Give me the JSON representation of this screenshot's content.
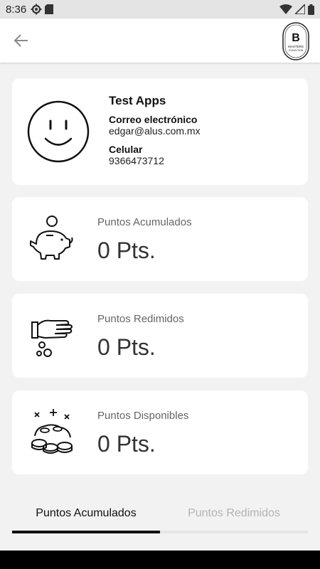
{
  "status_bar": {
    "time": "8:36"
  },
  "app_bar": {
    "back_icon": "arrow-left-icon",
    "logo_letter": "B",
    "logo_line1": "MASTERS",
    "logo_line2": "COLLECTION"
  },
  "profile": {
    "name": "Test Apps",
    "email_label": "Correo electrónico",
    "email": "edgar@alus.com.mx",
    "phone_label": "Celular",
    "phone": "9366473712"
  },
  "cards": [
    {
      "icon": "piggy-bank-icon",
      "title": "Puntos Acumulados",
      "value": "0 Pts."
    },
    {
      "icon": "hand-coins-icon",
      "title": "Puntos Redimidos",
      "value": "0 Pts."
    },
    {
      "icon": "coins-pile-icon",
      "title": "Puntos Disponibles",
      "value": "0 Pts."
    }
  ],
  "tabs": {
    "left": "Puntos Acumulados",
    "right": "Puntos Redimidos",
    "active": "left"
  },
  "colors": {
    "background": "#f2f2f2",
    "card": "#ffffff",
    "text": "#111111",
    "muted": "#b3b3b3"
  }
}
